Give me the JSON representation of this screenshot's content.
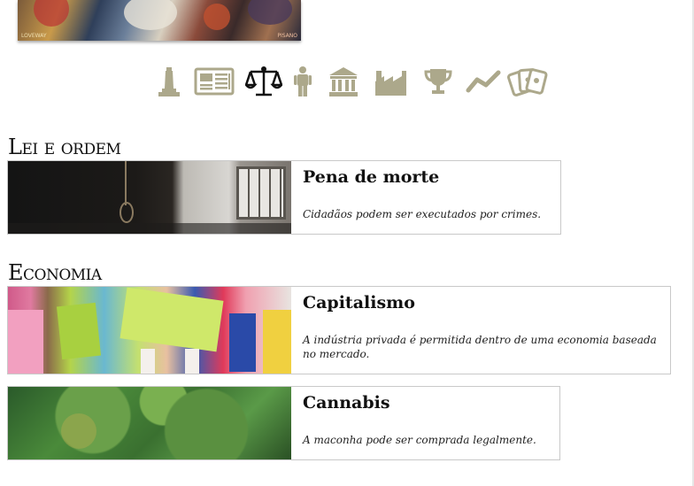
{
  "banner": {
    "text_left": "LOVEWAY",
    "text_right": "PISANO"
  },
  "icons": [
    "monument-icon",
    "newspaper-icon",
    "scales-of-justice-icon",
    "person-icon",
    "government-building-icon",
    "factory-icon",
    "trophy-icon",
    "trend-line-icon",
    "playing-cards-icon"
  ],
  "colors": {
    "icon_inactive": "#aca88b",
    "icon_active": "#111111",
    "card_border": "#c9c9c9"
  },
  "sections": [
    {
      "title": "Lei e ordem",
      "cards": [
        {
          "title": "Pena de morte",
          "description": "Cidadãos podem ser executados por crimes."
        }
      ]
    },
    {
      "title": "Economia",
      "cards": [
        {
          "title": "Capitalismo",
          "description": "A indústria privada é permitida dentro de uma economia baseada no mercado."
        },
        {
          "title": "Cannabis",
          "description": "A maconha pode ser comprada legalmente."
        }
      ]
    }
  ]
}
